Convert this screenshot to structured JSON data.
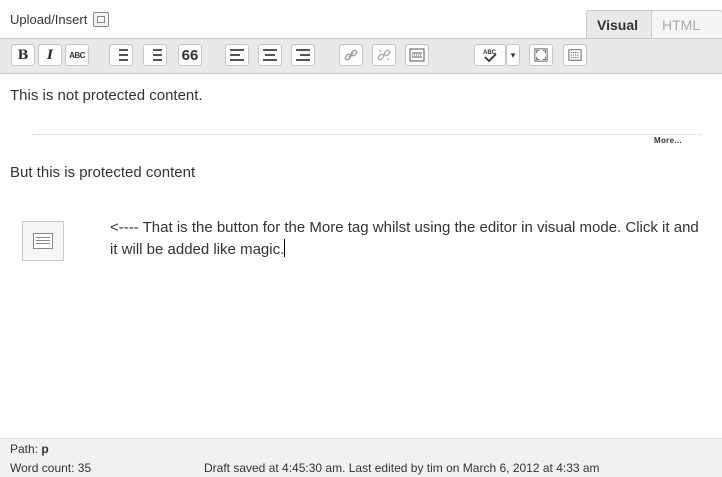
{
  "header": {
    "upload_label": "Upload/Insert",
    "tabs": [
      {
        "label": "Visual",
        "active": true
      },
      {
        "label": "HTML",
        "active": false
      }
    ]
  },
  "toolbar": {
    "buttons": [
      {
        "name": "bold",
        "glyph": "B"
      },
      {
        "name": "italic",
        "glyph": "I"
      },
      {
        "name": "strikethrough",
        "glyph": "ABC"
      },
      {
        "name": "quote",
        "glyph": "66"
      }
    ],
    "spellcheck_dropdown": "▾"
  },
  "content": {
    "paragraph_1": "This is not protected content.",
    "more_tag": "More...",
    "paragraph_2": "But this is protected content",
    "paragraph_3": "<---- That is the button for the More tag whilst using the editor in visual mode. Click it and it will be added like magic."
  },
  "status": {
    "path_label": "Path:",
    "path_value": "p",
    "word_count": "Word count: 35",
    "draft_status": "Draft saved at 4:45:30 am. Last edited by tim on March 6, 2012 at 4:33 am"
  }
}
